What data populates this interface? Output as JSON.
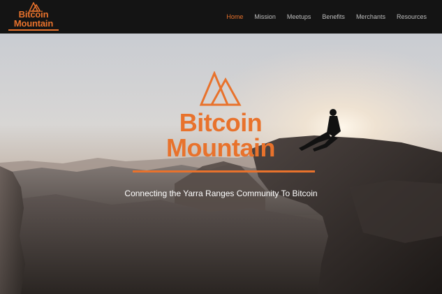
{
  "brand": {
    "title": "Bitcoin Mountain",
    "icon": "triangle-logo-icon"
  },
  "nav": {
    "items": [
      {
        "label": "Home",
        "active": true
      },
      {
        "label": "Mission",
        "active": false
      },
      {
        "label": "Meetups",
        "active": false
      },
      {
        "label": "Benefits",
        "active": false
      },
      {
        "label": "Merchants",
        "active": false
      },
      {
        "label": "Resources",
        "active": false
      }
    ]
  },
  "hero": {
    "title": "Bitcoin Mountain",
    "tagline": "Connecting the Yarra Ranges Community To Bitcoin",
    "icon": "triangle-logo-icon"
  },
  "colors": {
    "accent": "#e8722c",
    "navbar_bg": "#141414",
    "nav_text": "#bdbdbd",
    "tagline": "#ffffff"
  }
}
